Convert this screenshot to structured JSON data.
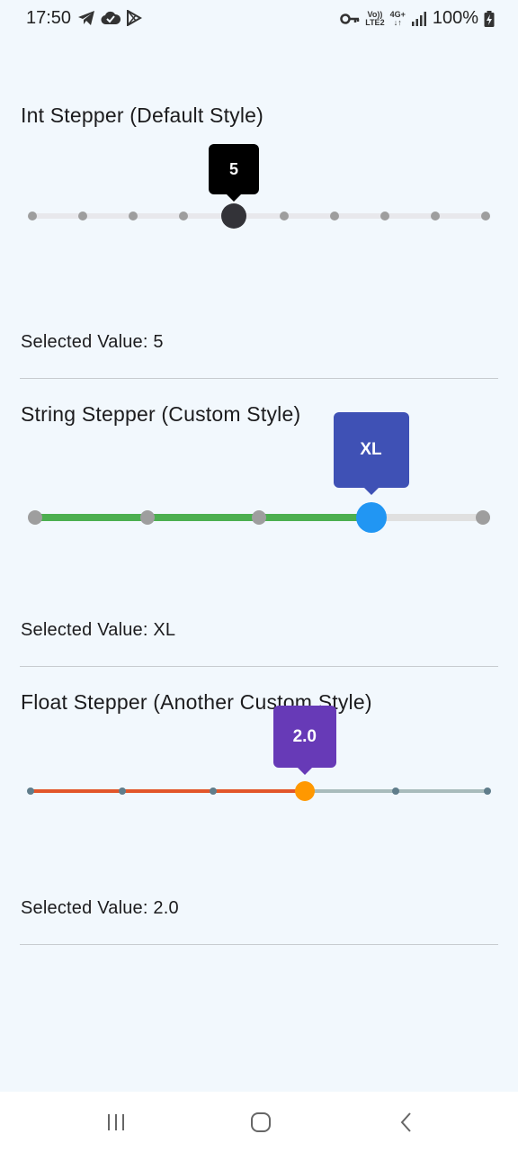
{
  "status_bar": {
    "time": "17:50",
    "left_icons": [
      "telegram-icon",
      "cloud-check-icon",
      "play-store-icon"
    ],
    "network_label_top": "Vo))",
    "network_label_bottom": "LTE2",
    "network_type_top": "4G+",
    "battery": "100%"
  },
  "int_stepper": {
    "title": "Int Stepper (Default Style)",
    "tooltip": "5",
    "selected_label": "Selected Value: 5",
    "step_count": 10,
    "selected_index": 4,
    "colors": {
      "track": "#e8e8ec",
      "dot": "#9e9e9e",
      "thumb": "#333338",
      "tooltip_bg": "#000000"
    }
  },
  "string_stepper": {
    "title": "String Stepper (Custom Style)",
    "tooltip": "XL",
    "selected_label": "Selected Value: XL",
    "step_count": 5,
    "selected_index": 3,
    "colors": {
      "active_track": "#4caf50",
      "inactive_track": "#e0e0e0",
      "dot": "#9e9e9e",
      "thumb": "#2196f3",
      "tooltip_bg": "#3f51b5"
    }
  },
  "float_stepper": {
    "title": "Float Stepper (Another Custom Style)",
    "tooltip": "2.0",
    "selected_label": "Selected Value: 2.0",
    "step_count": 6,
    "selected_index": 3,
    "colors": {
      "active_track": "#e2562a",
      "inactive_track": "#a9bcbc",
      "dot": "#607d8b",
      "thumb": "#ff9800",
      "tooltip_bg": "#673ab7"
    }
  },
  "nav_bar": {
    "items": [
      "recent-apps-icon",
      "home-icon",
      "back-icon"
    ]
  }
}
